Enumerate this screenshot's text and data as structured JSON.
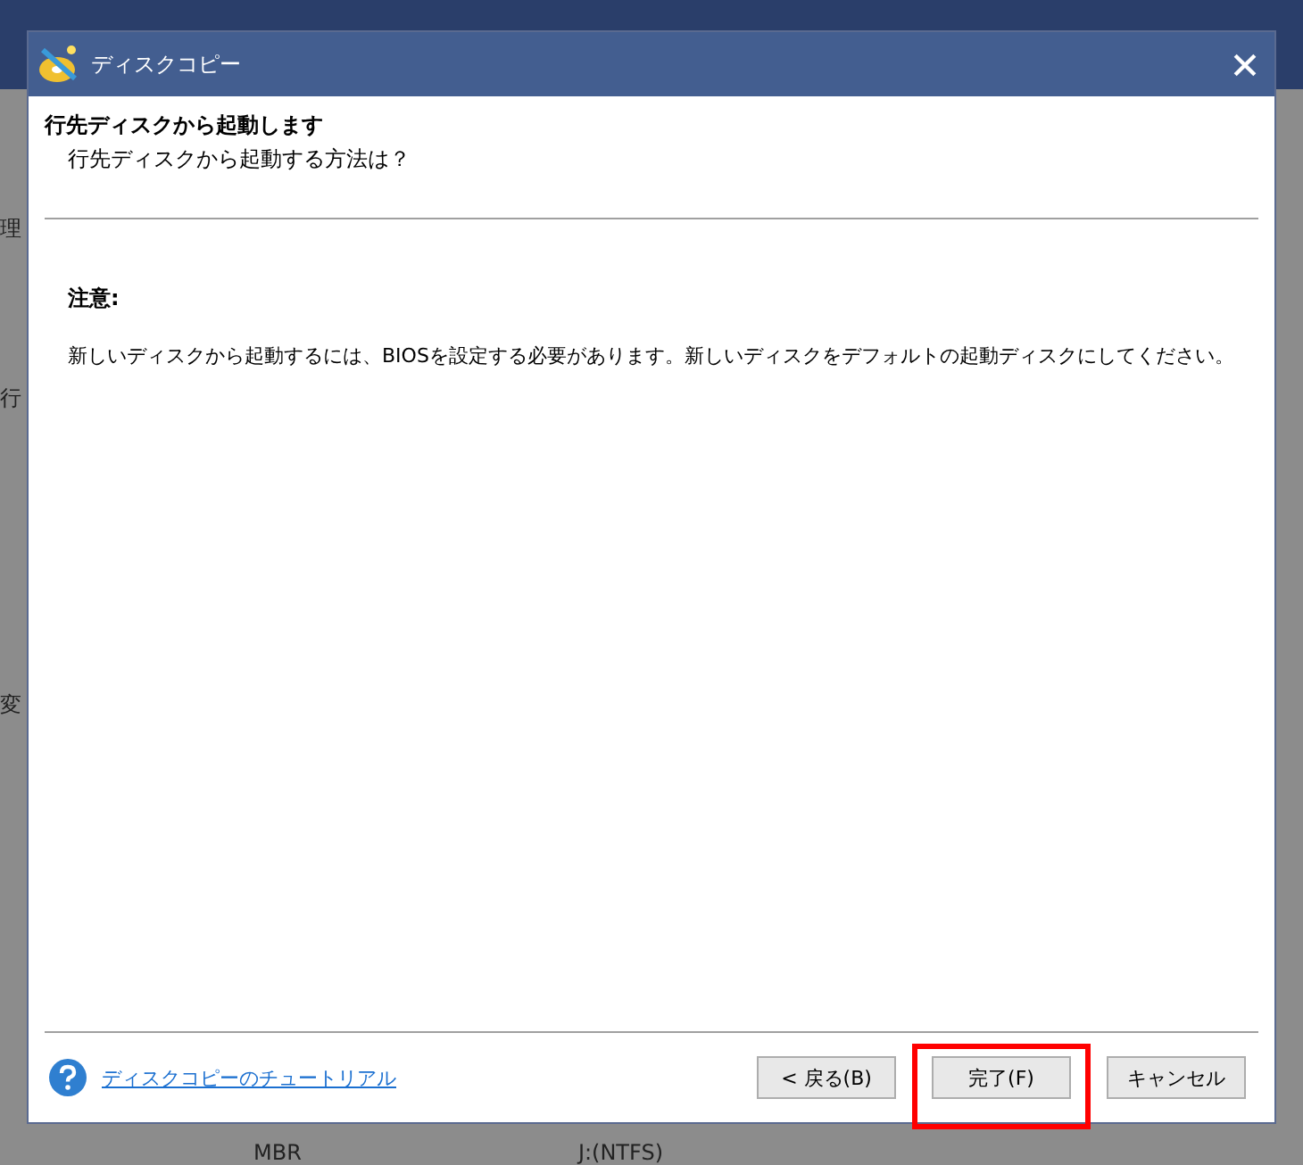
{
  "background": {
    "left_labels": [
      "理",
      "行",
      "変"
    ],
    "bottom_texts": [
      "MBR",
      "J:(NTFS)"
    ]
  },
  "window": {
    "title": "ディスクコピー"
  },
  "header": {
    "title": "行先ディスクから起動します",
    "subtitle": "行先ディスクから起動する方法は？"
  },
  "note": {
    "heading": "注意:",
    "text": "新しいディスクから起動するには、BIOSを設定する必要があります。新しいディスクをデフォルトの起動ディスクにしてください。"
  },
  "help_link": "ディスクコピーのチュートリアル",
  "buttons": [
    {
      "label": "< 戻る(B)",
      "highlighted": false
    },
    {
      "label": "完了(F)",
      "highlighted": true
    },
    {
      "label": "キャンセル",
      "highlighted": false
    }
  ]
}
